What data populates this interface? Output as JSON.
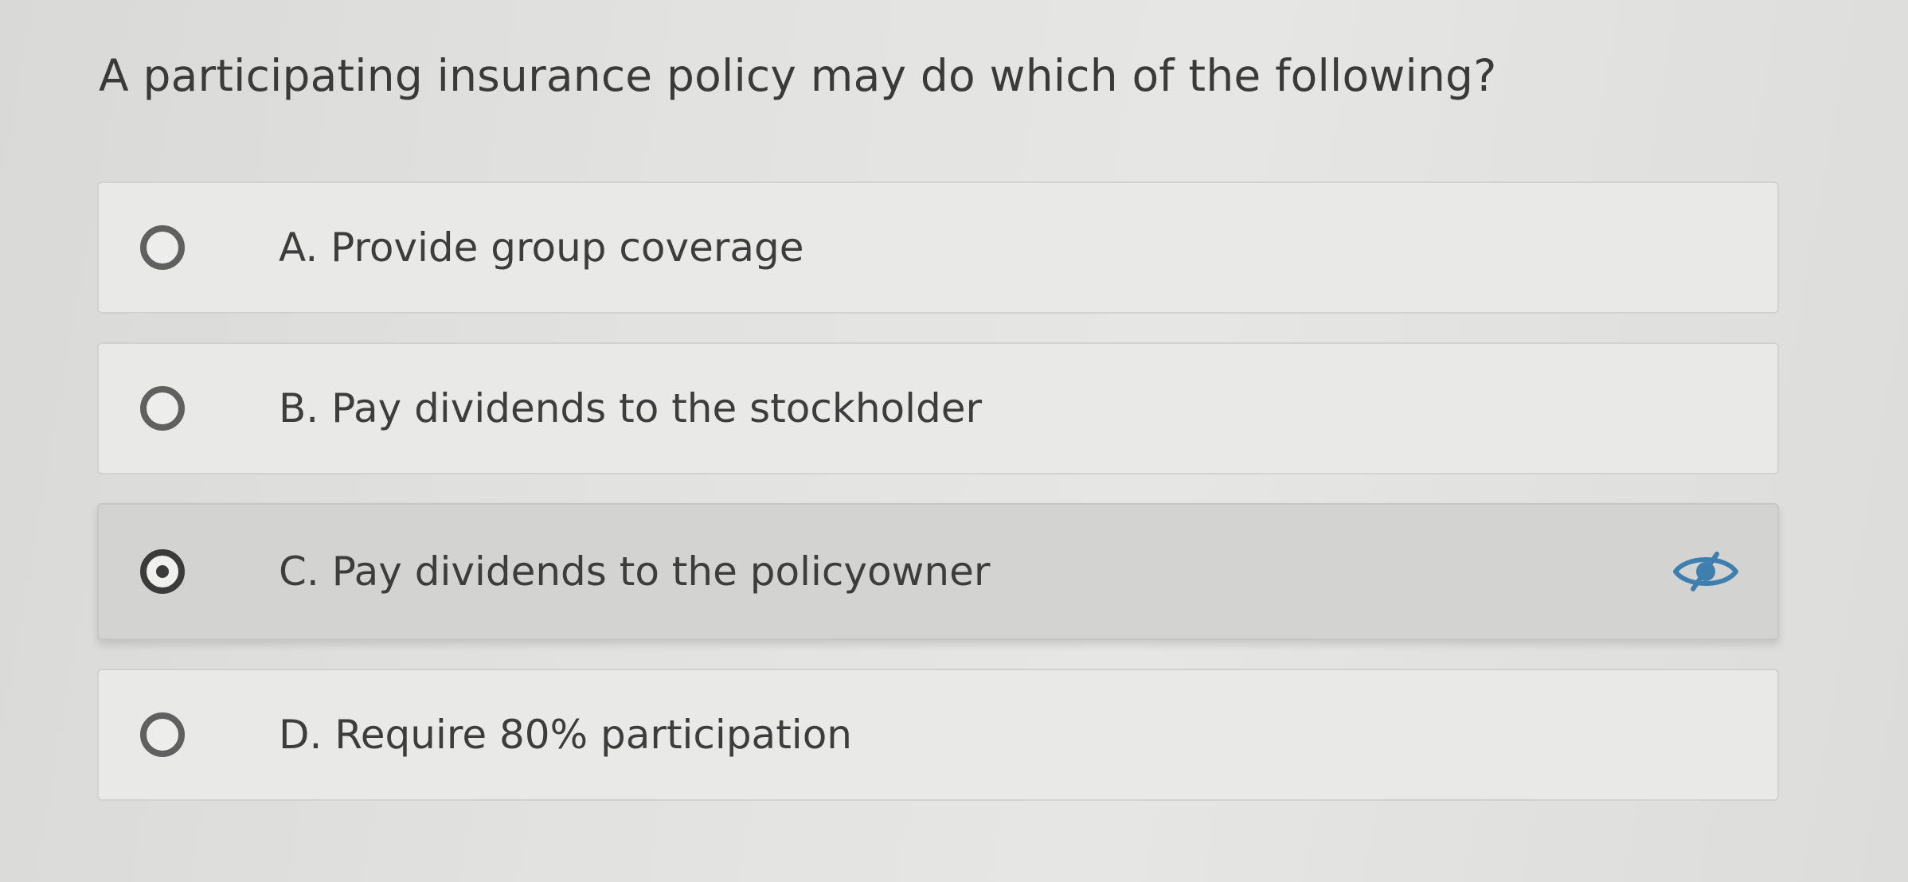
{
  "question": {
    "text": "A participating insurance policy may do which of the following?"
  },
  "options": [
    {
      "label": "A. Provide group coverage",
      "selected": false
    },
    {
      "label": "B. Pay dividends to the stockholder",
      "selected": false
    },
    {
      "label": "C. Pay dividends to the policyowner",
      "selected": true,
      "icon": "eye-slash-icon"
    },
    {
      "label": "D. Require 80% participation",
      "selected": false
    }
  ],
  "colors": {
    "eye_icon": "#3f7fb0",
    "radio_border": "#606060",
    "selected_bg": "#d3d3d1",
    "option_bg": "#e9e9e7"
  }
}
